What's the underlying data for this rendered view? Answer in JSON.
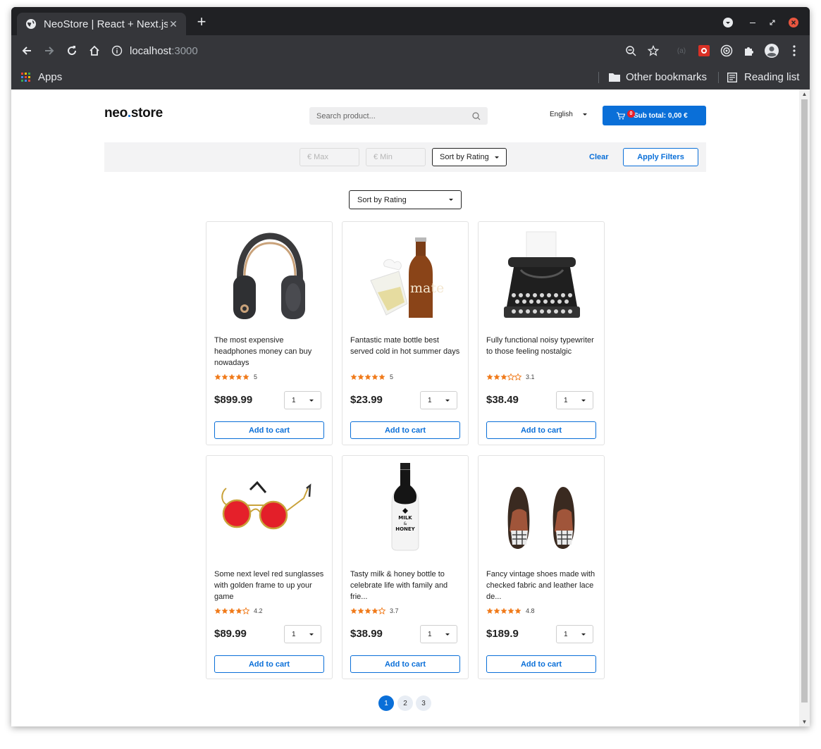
{
  "browser": {
    "tab_title": "NeoStore | React + Next.js",
    "url_host": "localhost",
    "url_port": ":3000",
    "bookmarks": {
      "apps": "Apps",
      "other": "Other bookmarks",
      "reading": "Reading list"
    }
  },
  "header": {
    "logo_left": "neo",
    "logo_dot": ".",
    "logo_right": "store",
    "search_placeholder": "Search product...",
    "language": "English",
    "cart_count": "0",
    "cart_label": "Sub total: 0,00 €"
  },
  "filters": {
    "max_placeholder": "€ Max",
    "min_placeholder": "€ Min",
    "sort_label": "Sort by Rating",
    "clear_label": "Clear",
    "apply_label": "Apply Filters"
  },
  "sort_select": "Sort by Rating",
  "products": [
    {
      "desc": "The most expensive headphones money can buy nowadays",
      "rating": "5",
      "stars": 5,
      "price": "$899.99",
      "qty": "1",
      "add": "Add to cart"
    },
    {
      "desc": "Fantastic mate bottle best served cold in hot summer days",
      "rating": "5",
      "stars": 5,
      "price": "$23.99",
      "qty": "1",
      "add": "Add to cart"
    },
    {
      "desc": "Fully functional noisy typewriter to those feeling nostalgic",
      "rating": "3.1",
      "stars": 3,
      "price": "$38.49",
      "qty": "1",
      "add": "Add to cart"
    },
    {
      "desc": "Some next level red sunglasses with golden frame to up your game",
      "rating": "4.2",
      "stars": 4,
      "price": "$89.99",
      "qty": "1",
      "add": "Add to cart"
    },
    {
      "desc": "Tasty milk & honey bottle to celebrate life with family and frie...",
      "rating": "3.7",
      "stars": 4,
      "price": "$38.99",
      "qty": "1",
      "add": "Add to cart"
    },
    {
      "desc": "Fancy vintage shoes made with checked fabric and leather lace de...",
      "rating": "4.8",
      "stars": 5,
      "price": "$189.9",
      "qty": "1",
      "add": "Add to cart"
    }
  ],
  "pagination": {
    "pages": [
      "1",
      "2",
      "3"
    ],
    "current": "1"
  },
  "colors": {
    "accent": "#0a6fd8",
    "star": "#f07a1a",
    "badge": "#e8202a"
  }
}
